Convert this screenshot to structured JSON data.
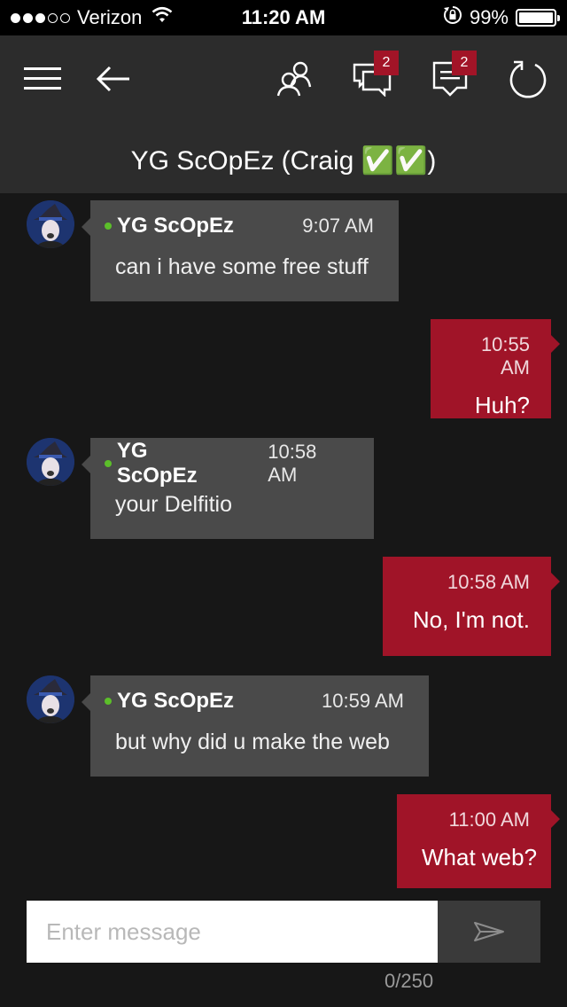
{
  "status_bar": {
    "carrier": "Verizon",
    "time": "11:20 AM",
    "battery": "99%",
    "battery_level": 0.99,
    "signal_bars": 3,
    "signal_max": 5
  },
  "nav": {
    "icons": [
      "menu-icon",
      "back-arrow-icon",
      "friends-icon",
      "conversations-icon",
      "messages-icon",
      "refresh-icon"
    ],
    "conversations_badge": "2",
    "messages_badge": "2"
  },
  "conversation": {
    "title": "YG ScOpEz (Craig ✅✅)"
  },
  "messages": [
    {
      "direction": "in",
      "sender": "YG ScOpEz",
      "time": "9:07 AM",
      "text": "can i have some free stuff"
    },
    {
      "direction": "out",
      "time": "10:55 AM",
      "text": "Huh?"
    },
    {
      "direction": "in",
      "sender": "YG ScOpEz",
      "time": "10:58 AM",
      "text": "your Delfitio"
    },
    {
      "direction": "out",
      "time": "10:58 AM",
      "text": "No, I'm not."
    },
    {
      "direction": "in",
      "sender": "YG ScOpEz",
      "time": "10:59 AM",
      "text": "but why did u make the web"
    },
    {
      "direction": "out",
      "time": "11:00 AM",
      "text": "What web?"
    }
  ],
  "composer": {
    "placeholder": "Enter message",
    "value": "",
    "char_count": "0/250"
  },
  "colors": {
    "accent": "#a01428",
    "incoming_bubble": "#4a4a4a",
    "presence_online": "#5cbf2a",
    "chat_background": "#171717",
    "header_background": "#2c2c2c"
  }
}
